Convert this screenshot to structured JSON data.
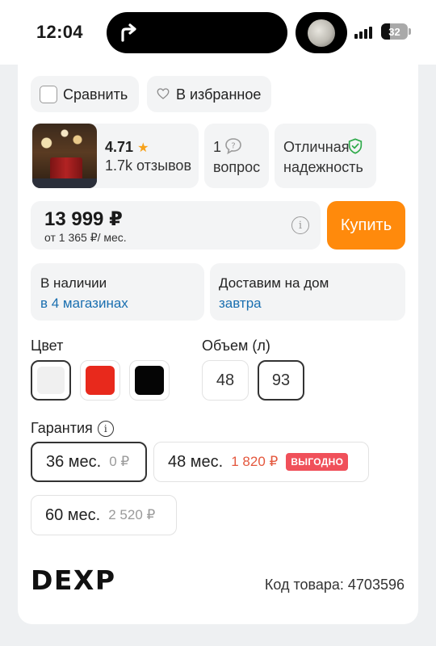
{
  "status_bar": {
    "time": "12:04",
    "battery": "32",
    "battery_level": 0.32
  },
  "actions": {
    "compare": "Сравнить",
    "favorite": "В избранное"
  },
  "rating": {
    "value": "4.71",
    "reviews": "1.7k отзывов"
  },
  "questions": {
    "count": "1",
    "label": "вопрос"
  },
  "reliability": {
    "line1": "Отличная",
    "line2": "надежность"
  },
  "price": {
    "main": "13 999 ₽",
    "installment": "от 1 365 ₽/ мес.",
    "buy_label": "Купить"
  },
  "availability": {
    "title": "В наличии",
    "link": "в 4 магазинах"
  },
  "delivery": {
    "title": "Доставим на дом",
    "link": "завтра"
  },
  "color": {
    "label": "Цвет",
    "options": [
      {
        "name": "white",
        "hex": "#f0f0f0",
        "selected": true
      },
      {
        "name": "red",
        "hex": "#e8291c",
        "selected": false
      },
      {
        "name": "black",
        "hex": "#050505",
        "selected": false
      }
    ]
  },
  "volume": {
    "label": "Объем (л)",
    "options": [
      "48",
      "93"
    ],
    "selected": "93"
  },
  "warranty": {
    "label": "Гарантия",
    "options": [
      {
        "term": "36 мес.",
        "price": "0 ₽",
        "selected": true
      },
      {
        "term": "48 мес.",
        "price": "1 820 ₽",
        "badge": "ВЫГОДНО"
      },
      {
        "term": "60 мес.",
        "price": "2 520 ₽"
      }
    ]
  },
  "brand": {
    "logo": "DEXP"
  },
  "product_code": "Код товара: 4703596",
  "colors": {
    "accent": "#ff8a0c",
    "link": "#1a6fb0",
    "badge": "#f0505a",
    "shield": "#2eaa4a"
  }
}
